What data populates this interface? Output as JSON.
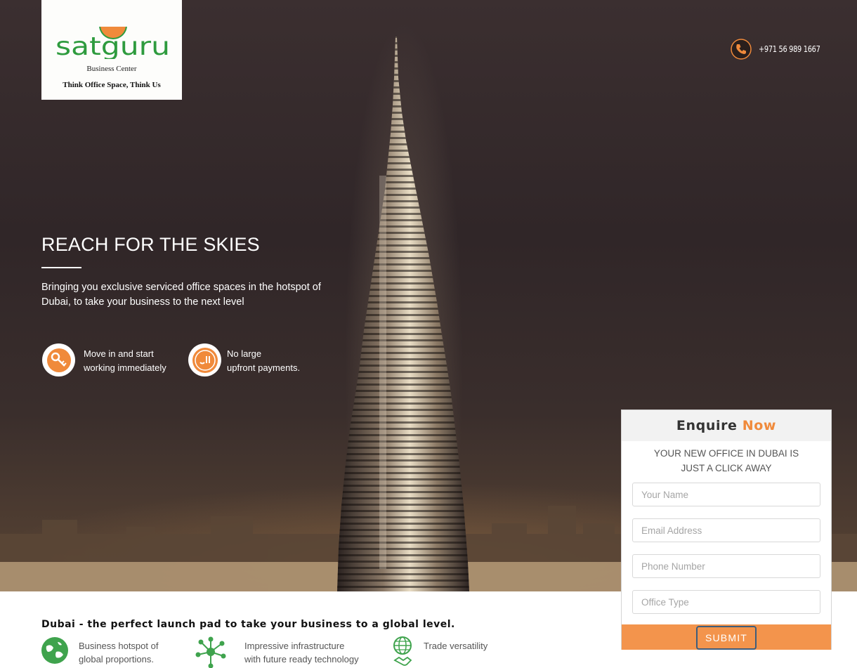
{
  "header": {
    "logo": {
      "wordmark": "satguru",
      "subtitle": "Business Center",
      "tagline": "Think Office Space, Think Us"
    },
    "phone": "+971 56 989 1667"
  },
  "hero": {
    "headline": "REACH FOR THE SKIES",
    "intro": "Bringing you exclusive serviced office spaces in the hotspot of Dubai, to take your business to the next level",
    "perks": [
      {
        "icon": "keys-icon",
        "line1": "Move in and start",
        "line2": "working immediately"
      },
      {
        "icon": "dirham-icon",
        "line1": "No large",
        "line2": "upfront payments."
      }
    ]
  },
  "enquiry": {
    "title_part1": "Enquire",
    "title_part2": "Now",
    "subtitle_line1": "YOUR NEW OFFICE IN DUBAI IS",
    "subtitle_line2": "JUST A CLICK AWAY",
    "fields": {
      "name": "Your Name",
      "email": "Email Address",
      "phone": "Phone Number",
      "office_type": "Office Type"
    },
    "submit_label": "SUBMIT"
  },
  "features": {
    "title": "Dubai - the perfect launch pad to take your business to a global level.",
    "items": [
      {
        "icon": "globe-icon",
        "line1": "Business hotspot of",
        "line2": "global proportions."
      },
      {
        "icon": "network-icon",
        "line1": "Impressive infrastructure",
        "line2": "with future ready technology"
      },
      {
        "icon": "globe-handshake-icon",
        "line1": "Trade versatility",
        "line2": ""
      }
    ]
  },
  "colors": {
    "accent": "#f08a3b",
    "button": "#f3944c",
    "logo_green": "#2e9b3e"
  }
}
